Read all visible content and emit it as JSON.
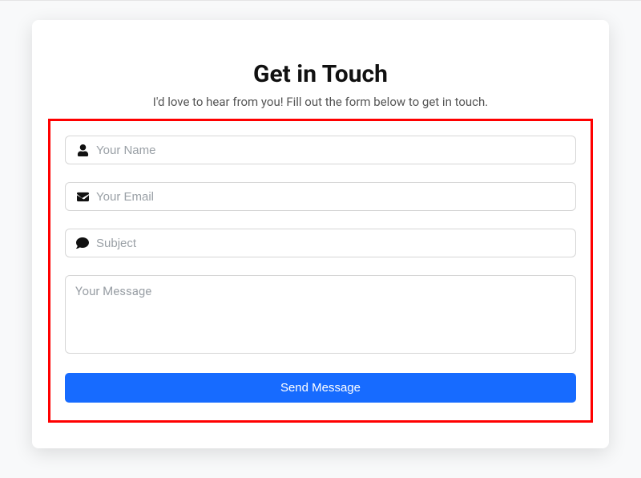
{
  "header": {
    "title": "Get in Touch",
    "subtitle": "I'd love to hear from you! Fill out the form below to get in touch."
  },
  "form": {
    "name": {
      "placeholder": "Your Name",
      "value": ""
    },
    "email": {
      "placeholder": "Your Email",
      "value": ""
    },
    "subject": {
      "placeholder": "Subject",
      "value": ""
    },
    "message": {
      "placeholder": "Your Message",
      "value": ""
    },
    "submit_label": "Send Message"
  }
}
